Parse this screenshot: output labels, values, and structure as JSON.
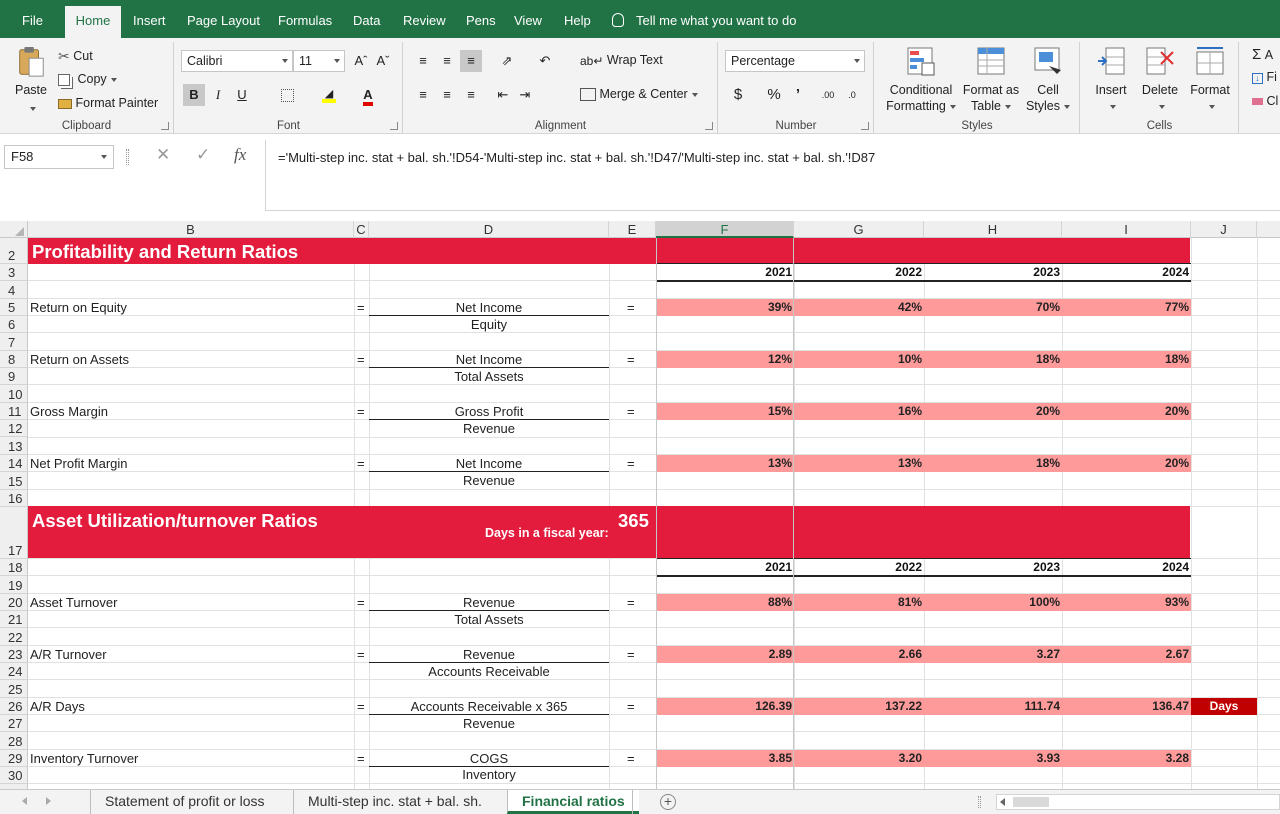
{
  "ribbon_tabs": [
    "File",
    "Home",
    "Insert",
    "Page Layout",
    "Formulas",
    "Data",
    "Review",
    "Pens",
    "View",
    "Help"
  ],
  "active_tab": "Home",
  "tell_me": "Tell me what you want to do",
  "clipboard": {
    "paste": "Paste",
    "cut": "Cut",
    "copy": "Copy",
    "format_painter": "Format Painter",
    "label": "Clipboard"
  },
  "font": {
    "name": "Calibri",
    "size": "11",
    "bold": "B",
    "italic": "I",
    "underline": "U",
    "label": "Font"
  },
  "alignment": {
    "wrap_text": "Wrap Text",
    "merge_center": "Merge & Center",
    "label": "Alignment"
  },
  "number": {
    "format": "Percentage",
    "currency": "$",
    "percent": "%",
    "comma": "’",
    "label": "Number"
  },
  "styles": {
    "conditional_1": "Conditional",
    "conditional_2": "Formatting",
    "format_table_1": "Format as",
    "format_table_2": "Table",
    "cell_styles_1": "Cell",
    "cell_styles_2": "Styles",
    "label": "Styles"
  },
  "cells_group": {
    "insert": "Insert",
    "delete": "Delete",
    "format": "Format",
    "label": "Cells"
  },
  "editing": {
    "sum": "A",
    "fill": "Fi",
    "clear": "Cl"
  },
  "name_box": "F58",
  "formula": "='Multi-step inc. stat + bal. sh.'!D54-'Multi-step inc. stat + bal. sh.'!D47/'Multi-step inc. stat + bal. sh.'!D87",
  "columns": [
    "B",
    "C",
    "D",
    "E",
    "F",
    "G",
    "H",
    "I",
    "J"
  ],
  "selected_column": "F",
  "rows": [
    "2",
    "3",
    "4",
    "5",
    "6",
    "7",
    "8",
    "9",
    "10",
    "11",
    "12",
    "13",
    "14",
    "15",
    "16",
    "17",
    "18",
    "19",
    "20",
    "21",
    "22",
    "23",
    "24",
    "25",
    "26",
    "27",
    "28",
    "29",
    "30"
  ],
  "section1": {
    "title": "Profitability and Return Ratios",
    "years": [
      "2021",
      "2022",
      "2023",
      "2024"
    ]
  },
  "section2": {
    "title": "Asset Utilization/turnover Ratios",
    "fiscal_label": "Days in a fiscal year:",
    "fiscal_days": "365",
    "years": [
      "2021",
      "2022",
      "2023",
      "2024"
    ]
  },
  "ratios": [
    {
      "name": "Return on Equity",
      "eq1": "=",
      "numerator": "Net Income",
      "denominator": "Equity",
      "eq2": "=",
      "values": [
        "39%",
        "42%",
        "70%",
        "77%"
      ]
    },
    {
      "name": "Return on Assets",
      "eq1": "=",
      "numerator": "Net Income",
      "denominator": "Total Assets",
      "eq2": "=",
      "values": [
        "12%",
        "10%",
        "18%",
        "18%"
      ]
    },
    {
      "name": "Gross Margin",
      "eq1": "=",
      "numerator": "Gross Profit",
      "denominator": "Revenue",
      "eq2": "=",
      "values": [
        "15%",
        "16%",
        "20%",
        "20%"
      ]
    },
    {
      "name": "Net Profit Margin",
      "eq1": "=",
      "numerator": "Net Income",
      "denominator": "Revenue",
      "eq2": "=",
      "values": [
        "13%",
        "13%",
        "18%",
        "20%"
      ]
    },
    {
      "name": "Asset Turnover",
      "eq1": "=",
      "numerator": "Revenue",
      "denominator": "Total Assets",
      "eq2": "=",
      "values": [
        "88%",
        "81%",
        "100%",
        "93%"
      ]
    },
    {
      "name": "A/R Turnover",
      "eq1": "=",
      "numerator": "Revenue",
      "denominator": "Accounts Receivable",
      "eq2": "=",
      "values": [
        "2.89",
        "2.66",
        "3.27",
        "2.67"
      ]
    },
    {
      "name": "A/R Days",
      "eq1": "=",
      "numerator": "Accounts Receivable x 365",
      "denominator": "Revenue",
      "eq2": "=",
      "values": [
        "126.39",
        "137.22",
        "111.74",
        "136.47"
      ],
      "unit": "Days"
    },
    {
      "name": "Inventory Turnover",
      "eq1": "=",
      "numerator": "COGS",
      "denominator": "Inventory",
      "eq2": "=",
      "values": [
        "3.85",
        "3.20",
        "3.93",
        "3.28"
      ]
    }
  ],
  "sheets": [
    "Statement of profit or loss",
    "Multi-step inc. stat + bal. sh.",
    "Financial ratios"
  ],
  "active_sheet": "Financial ratios",
  "colors": {
    "excel_green": "#217346",
    "banner_red": "#e31b3c",
    "highlight_pink": "#ff9a9a",
    "days_red": "#c00000"
  }
}
